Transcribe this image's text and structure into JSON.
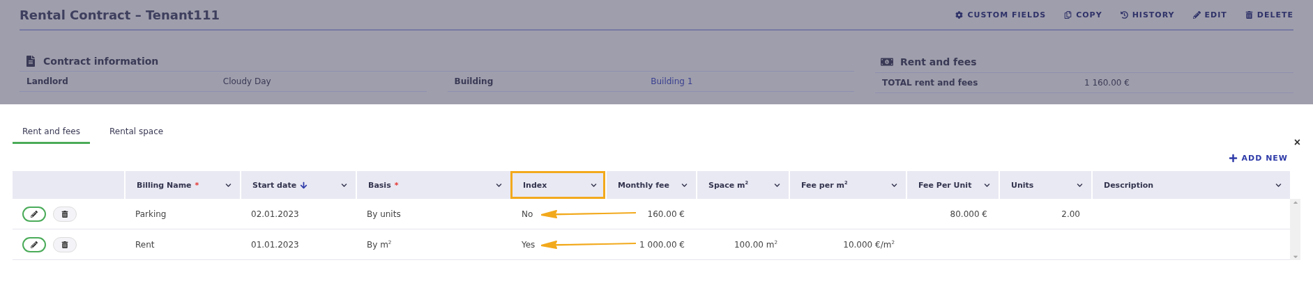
{
  "page": {
    "title": "Rental Contract – Tenant111",
    "actions": [
      {
        "kind": "gear",
        "label": "CUSTOM FIELDS"
      },
      {
        "kind": "copy",
        "label": "COPY"
      },
      {
        "kind": "history",
        "label": "HISTORY"
      },
      {
        "kind": "edit",
        "label": "EDIT"
      },
      {
        "kind": "delete",
        "label": "DELETE"
      }
    ],
    "contract_information": {
      "title": "Contract information",
      "fields": [
        {
          "label": "Landlord",
          "value": "Cloudy Day",
          "link": false
        },
        {
          "label": "Building",
          "value": "Building 1",
          "link": true
        }
      ]
    },
    "rent_and_fees": {
      "title": "Rent and fees",
      "fields": [
        {
          "label": "TOTAL rent and fees",
          "value": "1 160.00 €"
        }
      ]
    }
  },
  "panel": {
    "close": "×",
    "tabs": [
      {
        "label": "Rent and fees",
        "selected": true
      },
      {
        "label": "Rental space",
        "selected": false
      }
    ],
    "add_new": "ADD NEW",
    "table": {
      "columns": [
        {
          "label": "Billing Name",
          "required_mark": "*",
          "sorted": false,
          "highlighted": false,
          "kind": "text"
        },
        {
          "label": "Start date",
          "sorted": true,
          "highlighted": false,
          "kind": "text"
        },
        {
          "label": "Basis",
          "required_mark": "*",
          "sorted": false,
          "highlighted": false,
          "kind": "text"
        },
        {
          "label": "Index",
          "sorted": false,
          "highlighted": true,
          "kind": "text"
        },
        {
          "label": "Monthly fee",
          "sorted": false,
          "highlighted": false,
          "kind": "number"
        },
        {
          "label": "Space m$^{2}$",
          "sorted": false,
          "highlighted": false,
          "kind": "number"
        },
        {
          "label": "Fee per m$^{2}$",
          "sorted": false,
          "highlighted": false,
          "kind": "number"
        },
        {
          "label": "Fee Per Unit",
          "sorted": false,
          "highlighted": false,
          "kind": "number"
        },
        {
          "label": "Units",
          "sorted": false,
          "highlighted": false,
          "kind": "number"
        },
        {
          "label": "Description",
          "sorted": false,
          "highlighted": false,
          "kind": "text"
        }
      ],
      "rows": [
        {
          "cells": [
            "Parking",
            "02.01.2023",
            "By units",
            "No",
            "160.00 €",
            "",
            "",
            "80.000 €",
            "2.00",
            ""
          ],
          "annotated": true
        },
        {
          "cells": [
            "Rent",
            "01.01.2023",
            "By m$^{2}$",
            "Yes",
            "1 000.00 €",
            "100.00 m$^{2}$",
            "10.000 €/m$^{2}$",
            "",
            "",
            ""
          ],
          "annotated": true
        }
      ]
    }
  }
}
